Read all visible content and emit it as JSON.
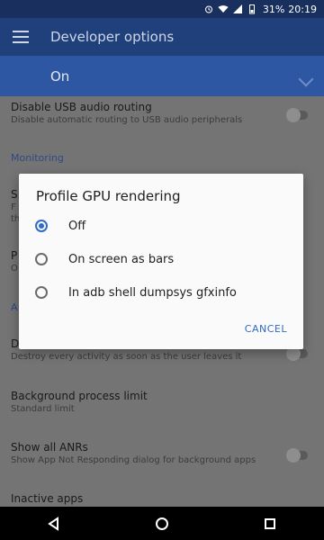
{
  "status_bar": {
    "battery_percent": "31%",
    "time": "20:19"
  },
  "app_bar": {
    "title": "Developer options"
  },
  "master_switch": {
    "label": "On"
  },
  "settings": {
    "usb_audio": {
      "title": "Disable USB audio routing",
      "subtitle": "Disable automatic routing to USB audio peripherals"
    },
    "section_monitoring": "Monitoring",
    "partial_1": {
      "title": "S",
      "subtitle_1": "F",
      "subtitle_2": "th"
    },
    "partial_2": {
      "title": "P",
      "subtitle": "O"
    },
    "section_partial": "A",
    "dont_keep": {
      "title": "D",
      "subtitle": "Destroy every activity as soon as the user leaves it"
    },
    "bg_limit": {
      "title": "Background process limit",
      "subtitle": "Standard limit"
    },
    "anrs": {
      "title": "Show all ANRs",
      "subtitle": "Show App Not Responding dialog for background apps"
    },
    "inactive": {
      "title": "Inactive apps"
    }
  },
  "dialog": {
    "title": "Profile GPU rendering",
    "options": [
      {
        "label": "Off",
        "selected": true
      },
      {
        "label": "On screen as bars",
        "selected": false
      },
      {
        "label": "In adb shell dumpsys gfxinfo",
        "selected": false
      }
    ],
    "cancel_label": "CANCEL"
  },
  "colors": {
    "primary_dark": "#19305f",
    "primary": "#20407c",
    "switch_bar": "#2d56a3",
    "accent": "#2f6bc7"
  }
}
